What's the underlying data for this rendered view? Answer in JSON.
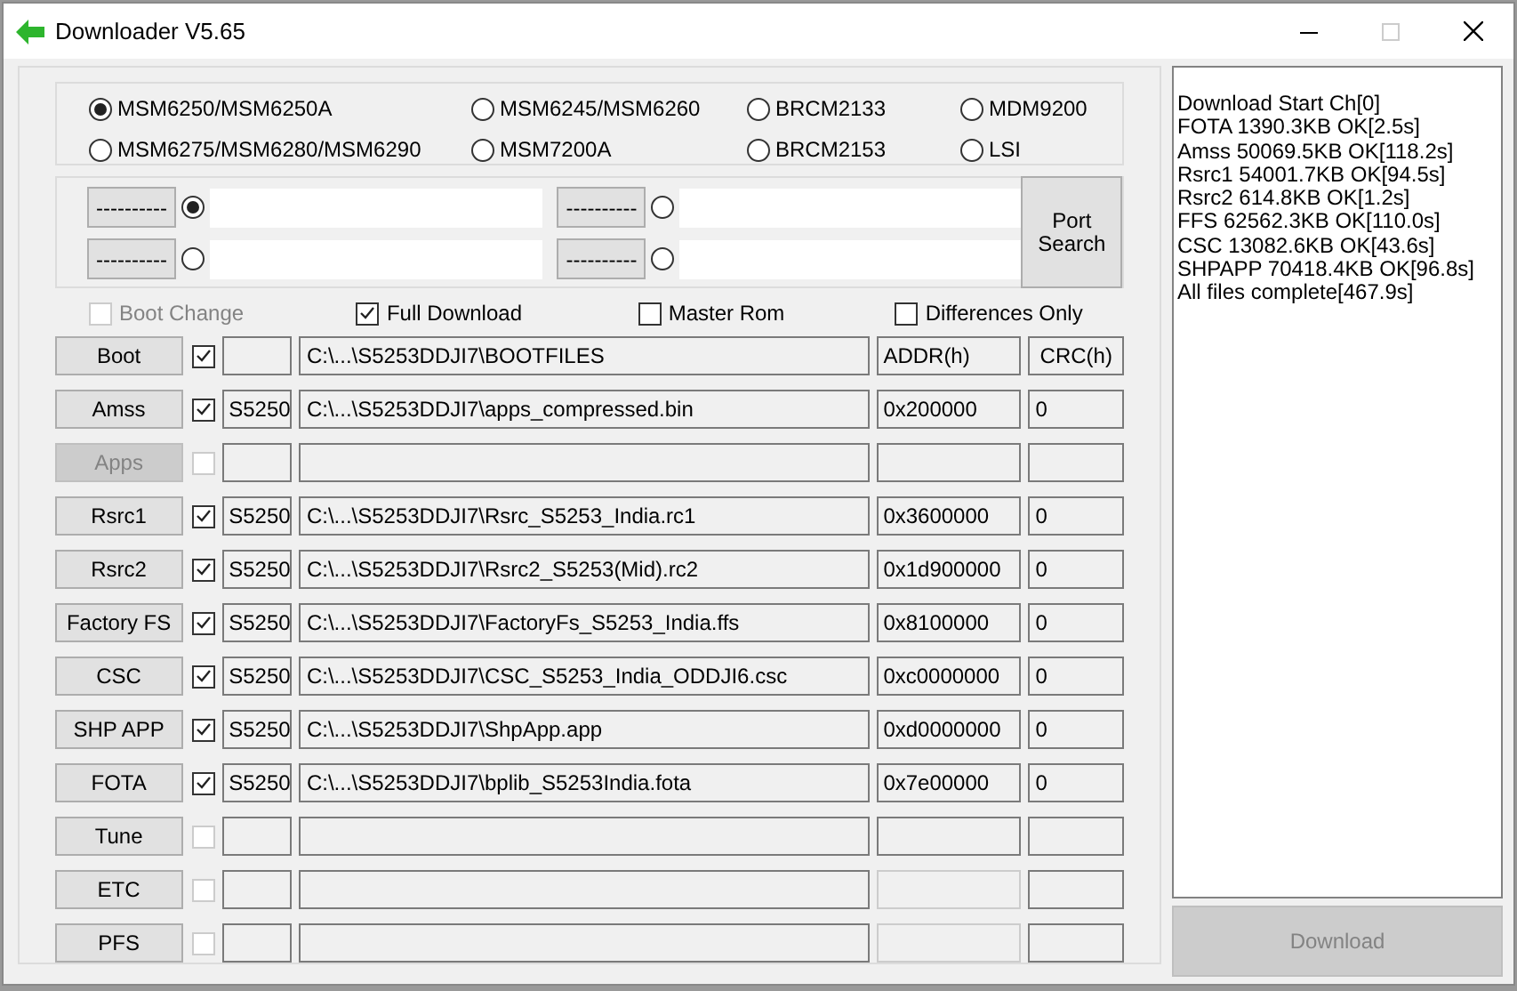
{
  "window": {
    "title": "Downloader V5.65"
  },
  "chipsets": [
    {
      "label": "MSM6250/MSM6250A",
      "selected": true
    },
    {
      "label": "MSM6245/MSM6260",
      "selected": false
    },
    {
      "label": "BRCM2133",
      "selected": false
    },
    {
      "label": "MDM9200",
      "selected": false
    },
    {
      "label": "MSM6275/MSM6280/MSM6290",
      "selected": false
    },
    {
      "label": "MSM7200A",
      "selected": false
    },
    {
      "label": "BRCM2153",
      "selected": false
    },
    {
      "label": "LSI",
      "selected": false
    }
  ],
  "ports": [
    {
      "button": "----------",
      "selected": true
    },
    {
      "button": "----------",
      "selected": false
    },
    {
      "button": "----------",
      "selected": false
    },
    {
      "button": "----------",
      "selected": false
    }
  ],
  "port_search": "Port\nSearch",
  "options": [
    {
      "label": "Boot Change",
      "checked": false,
      "disabled": true
    },
    {
      "label": "Full Download",
      "checked": true,
      "disabled": false
    },
    {
      "label": "Master Rom",
      "checked": false,
      "disabled": false
    },
    {
      "label": "Differences Only",
      "checked": false,
      "disabled": false
    }
  ],
  "files": [
    {
      "button": "Boot",
      "button_disabled": false,
      "checked": true,
      "check_disabled": false,
      "path": "C:\\...\\S5253DDJI7\\BOOTFILES",
      "addr": "ADDR(h)",
      "crc": "CRC(h)",
      "addr_disabled": false
    },
    {
      "button": "Amss",
      "button_disabled": false,
      "checked": true,
      "check_disabled": false,
      "model": "S5250",
      "path": "C:\\...\\S5253DDJI7\\apps_compressed.bin",
      "addr": "0x200000",
      "crc": "0",
      "addr_disabled": false
    },
    {
      "button": "Apps",
      "button_disabled": true,
      "checked": false,
      "check_disabled": true,
      "addr_disabled": false
    },
    {
      "button": "Rsrc1",
      "button_disabled": false,
      "checked": true,
      "check_disabled": false,
      "model": "S5250",
      "path": "C:\\...\\S5253DDJI7\\Rsrc_S5253_India.rc1",
      "addr": "0x3600000",
      "crc": "0",
      "addr_disabled": false
    },
    {
      "button": "Rsrc2",
      "button_disabled": false,
      "checked": true,
      "check_disabled": false,
      "model": "S5250",
      "path": "C:\\...\\S5253DDJI7\\Rsrc2_S5253(Mid).rc2",
      "addr": "0x1d900000",
      "crc": "0",
      "addr_disabled": false
    },
    {
      "button": "Factory FS",
      "button_disabled": false,
      "checked": true,
      "check_disabled": false,
      "model": "S5250",
      "path": "C:\\...\\S5253DDJI7\\FactoryFs_S5253_India.ffs",
      "addr": "0x8100000",
      "crc": "0",
      "addr_disabled": false
    },
    {
      "button": "CSC",
      "button_disabled": false,
      "checked": true,
      "check_disabled": false,
      "model": "S5250",
      "path": "C:\\...\\S5253DDJI7\\CSC_S5253_India_ODDJI6.csc",
      "addr": "0xc0000000",
      "crc": "0",
      "addr_disabled": false
    },
    {
      "button": "SHP APP",
      "button_disabled": false,
      "checked": true,
      "check_disabled": false,
      "model": "S5250",
      "path": "C:\\...\\S5253DDJI7\\ShpApp.app",
      "addr": "0xd0000000",
      "crc": "0",
      "addr_disabled": false
    },
    {
      "button": "FOTA",
      "button_disabled": false,
      "checked": true,
      "check_disabled": false,
      "model": "S5250",
      "path": "C:\\...\\S5253DDJI7\\bplib_S5253India.fota",
      "addr": "0x7e00000",
      "crc": "0",
      "addr_disabled": false
    },
    {
      "button": "Tune",
      "button_disabled": false,
      "checked": false,
      "check_disabled": true,
      "addr_disabled": false
    },
    {
      "button": "ETC",
      "button_disabled": false,
      "checked": false,
      "check_disabled": true,
      "addr_disabled": true
    },
    {
      "button": "PFS",
      "button_disabled": false,
      "checked": false,
      "check_disabled": true,
      "addr_disabled": true
    }
  ],
  "log": [
    "Download Start Ch[0]",
    "FOTA 1390.3KB OK[2.5s]",
    "Amss 50069.5KB OK[118.2s]",
    "Rsrc1 54001.7KB OK[94.5s]",
    "Rsrc2 614.8KB OK[1.2s]",
    "FFS 62562.3KB OK[110.0s]",
    "CSC 13082.6KB OK[43.6s]",
    "SHPAPP 70418.4KB OK[96.8s]",
    "All files complete[467.9s]"
  ],
  "download_button": {
    "label": "Download",
    "disabled": true
  }
}
